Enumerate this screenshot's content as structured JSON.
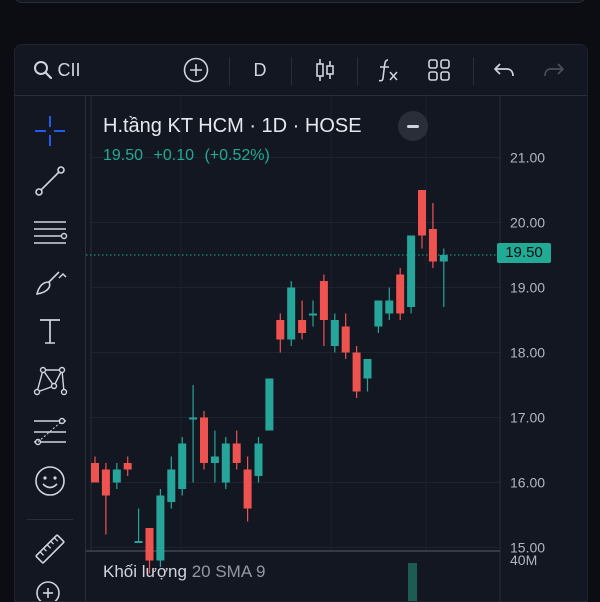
{
  "toolbar": {
    "symbol": "CII",
    "interval": "D"
  },
  "legend": {
    "title": "H.tầng KT HCM · 1D · HOSE",
    "last": "19.50",
    "change": "+0.10",
    "change_pct": "(+0.52%)"
  },
  "volume_legend": {
    "label": "Khối lượng",
    "settings": "20 SMA 9"
  },
  "price_axis": {
    "ticks": [
      "21.00",
      "20.00",
      "19.00",
      "18.00",
      "17.00",
      "16.00",
      "15.00"
    ],
    "last_price_label": "19.50",
    "volume_tick": "40M"
  },
  "colors": {
    "up": "#26a69a",
    "down": "#ef5350",
    "background": "#131722",
    "grid": "#1e222d"
  },
  "chart_data": {
    "type": "candlestick",
    "y_range": [
      14.4,
      21.2
    ],
    "last_price": 19.5,
    "candles": [
      {
        "o": 16.3,
        "h": 16.4,
        "l": 16.0,
        "c": 16.0
      },
      {
        "o": 16.2,
        "h": 16.3,
        "l": 15.2,
        "c": 15.8
      },
      {
        "o": 16.0,
        "h": 16.3,
        "l": 15.9,
        "c": 16.2
      },
      {
        "o": 16.3,
        "h": 16.4,
        "l": 16.1,
        "c": 16.2
      },
      {
        "o": 15.1,
        "h": 15.6,
        "l": 15.1,
        "c": 15.1
      },
      {
        "o": 15.3,
        "h": 15.3,
        "l": 14.6,
        "c": 14.8
      },
      {
        "o": 14.8,
        "h": 15.9,
        "l": 14.7,
        "c": 15.8
      },
      {
        "o": 15.7,
        "h": 16.4,
        "l": 15.6,
        "c": 16.2
      },
      {
        "o": 15.9,
        "h": 16.7,
        "l": 15.8,
        "c": 16.6
      },
      {
        "o": 17.0,
        "h": 17.5,
        "l": 16.0,
        "c": 17.0
      },
      {
        "o": 17.0,
        "h": 17.1,
        "l": 16.2,
        "c": 16.3
      },
      {
        "o": 16.3,
        "h": 16.8,
        "l": 16.0,
        "c": 16.4
      },
      {
        "o": 16.0,
        "h": 16.7,
        "l": 15.9,
        "c": 16.6
      },
      {
        "o": 16.6,
        "h": 16.8,
        "l": 16.2,
        "c": 16.3
      },
      {
        "o": 16.2,
        "h": 16.4,
        "l": 15.4,
        "c": 15.6
      },
      {
        "o": 16.1,
        "h": 16.7,
        "l": 16.0,
        "c": 16.6
      },
      {
        "o": 16.8,
        "h": 17.1,
        "l": 16.8,
        "c": 17.6
      },
      {
        "o": 18.5,
        "h": 18.6,
        "l": 18.0,
        "c": 18.2
      },
      {
        "o": 18.2,
        "h": 19.1,
        "l": 18.1,
        "c": 19.0
      },
      {
        "o": 18.5,
        "h": 18.8,
        "l": 18.2,
        "c": 18.3
      },
      {
        "o": 18.6,
        "h": 18.8,
        "l": 18.4,
        "c": 18.6
      },
      {
        "o": 19.1,
        "h": 19.2,
        "l": 18.1,
        "c": 18.5
      },
      {
        "o": 18.1,
        "h": 18.6,
        "l": 18.0,
        "c": 18.5
      },
      {
        "o": 18.4,
        "h": 18.6,
        "l": 17.9,
        "c": 18.0
      },
      {
        "o": 18.0,
        "h": 18.1,
        "l": 17.3,
        "c": 17.4
      },
      {
        "o": 17.6,
        "h": 17.9,
        "l": 17.4,
        "c": 17.9
      },
      {
        "o": 18.4,
        "h": 18.8,
        "l": 18.3,
        "c": 18.8
      },
      {
        "o": 18.6,
        "h": 19.0,
        "l": 18.5,
        "c": 18.8
      },
      {
        "o": 19.2,
        "h": 19.3,
        "l": 18.5,
        "c": 18.6
      },
      {
        "o": 18.7,
        "h": 19.6,
        "l": 18.6,
        "c": 19.8
      },
      {
        "o": 20.5,
        "h": 20.5,
        "l": 19.6,
        "c": 19.8
      },
      {
        "o": 19.9,
        "h": 20.3,
        "l": 19.3,
        "c": 19.4
      },
      {
        "o": 19.4,
        "h": 19.6,
        "l": 18.7,
        "c": 19.5
      }
    ]
  }
}
